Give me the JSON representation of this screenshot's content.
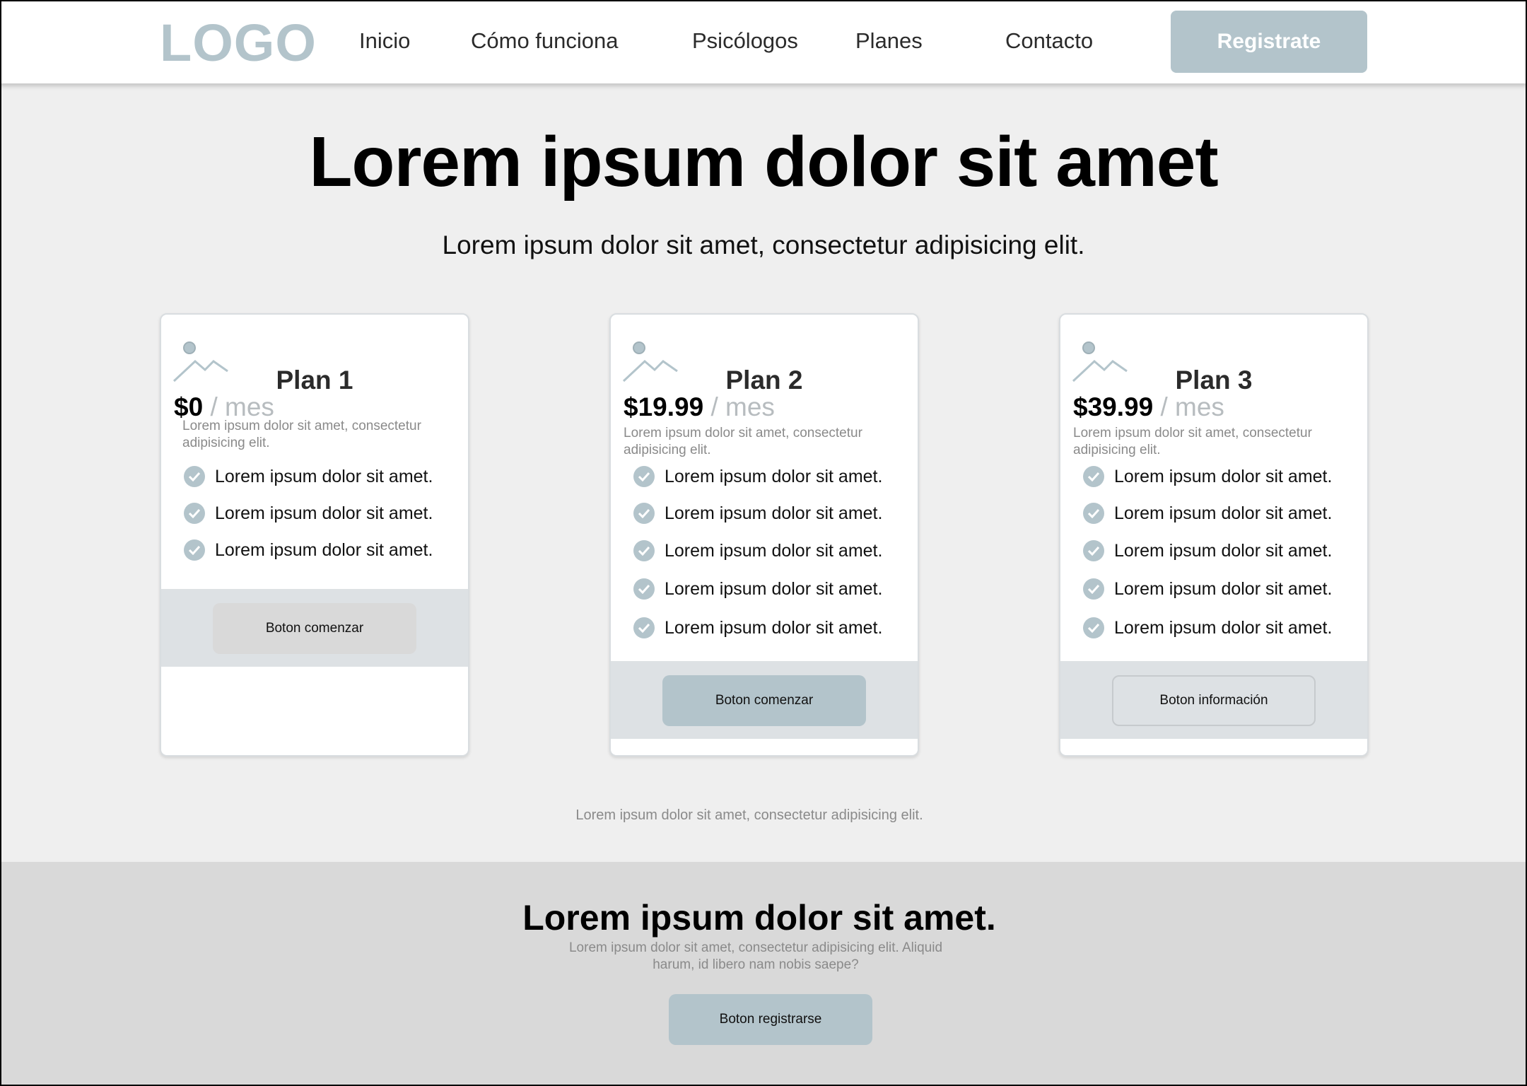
{
  "nav": {
    "logo": "LOGO",
    "items": [
      "Inicio",
      "Cómo funciona",
      "Psicólogos",
      "Planes",
      "Contacto"
    ],
    "register_label": "Registrate"
  },
  "hero": {
    "title": "Lorem ipsum dolor sit amet",
    "subtitle": "Lorem ipsum dolor sit amet, consectetur adipisicing elit."
  },
  "plans": [
    {
      "name": "Plan 1",
      "price": "$0",
      "unit": "/ mes",
      "description": "Lorem ipsum dolor sit amet, consectetur adipisicing elit.",
      "features": [
        "Lorem ipsum dolor sit amet.",
        "Lorem ipsum dolor sit amet.",
        "Lorem ipsum dolor sit amet."
      ],
      "button": "Boton comenzar"
    },
    {
      "name": "Plan 2",
      "price": "$19.99",
      "unit": "/ mes",
      "description": "Lorem ipsum dolor sit amet, consectetur adipisicing elit.",
      "features": [
        "Lorem ipsum dolor sit amet.",
        "Lorem ipsum dolor sit amet.",
        "Lorem ipsum dolor sit amet.",
        "Lorem ipsum dolor sit amet.",
        "Lorem ipsum dolor sit amet."
      ],
      "button": "Boton comenzar"
    },
    {
      "name": "Plan 3",
      "price": "$39.99",
      "unit": "/ mes",
      "description": "Lorem ipsum dolor sit amet, consectetur adipisicing elit.",
      "features": [
        "Lorem ipsum dolor sit amet.",
        "Lorem ipsum dolor sit amet.",
        "Lorem ipsum dolor sit amet.",
        "Lorem ipsum dolor sit amet.",
        "Lorem ipsum dolor sit amet."
      ],
      "button": "Boton información"
    }
  ],
  "note": "Lorem ipsum dolor sit amet, consectetur adipisicing elit.",
  "cta": {
    "title": "Lorem ipsum dolor sit amet.",
    "text": "Lorem ipsum dolor sit amet, consectetur adipisicing elit. Aliquid harum, id libero nam nobis saepe?",
    "button": "Boton registrarse"
  },
  "colors": {
    "accent": "#b3c4cb",
    "background": "#efefef",
    "footer_band": "#d9d9d9",
    "card_footer": "#dde1e4"
  },
  "icons": [
    "image-placeholder-icon",
    "check-circle-icon"
  ]
}
